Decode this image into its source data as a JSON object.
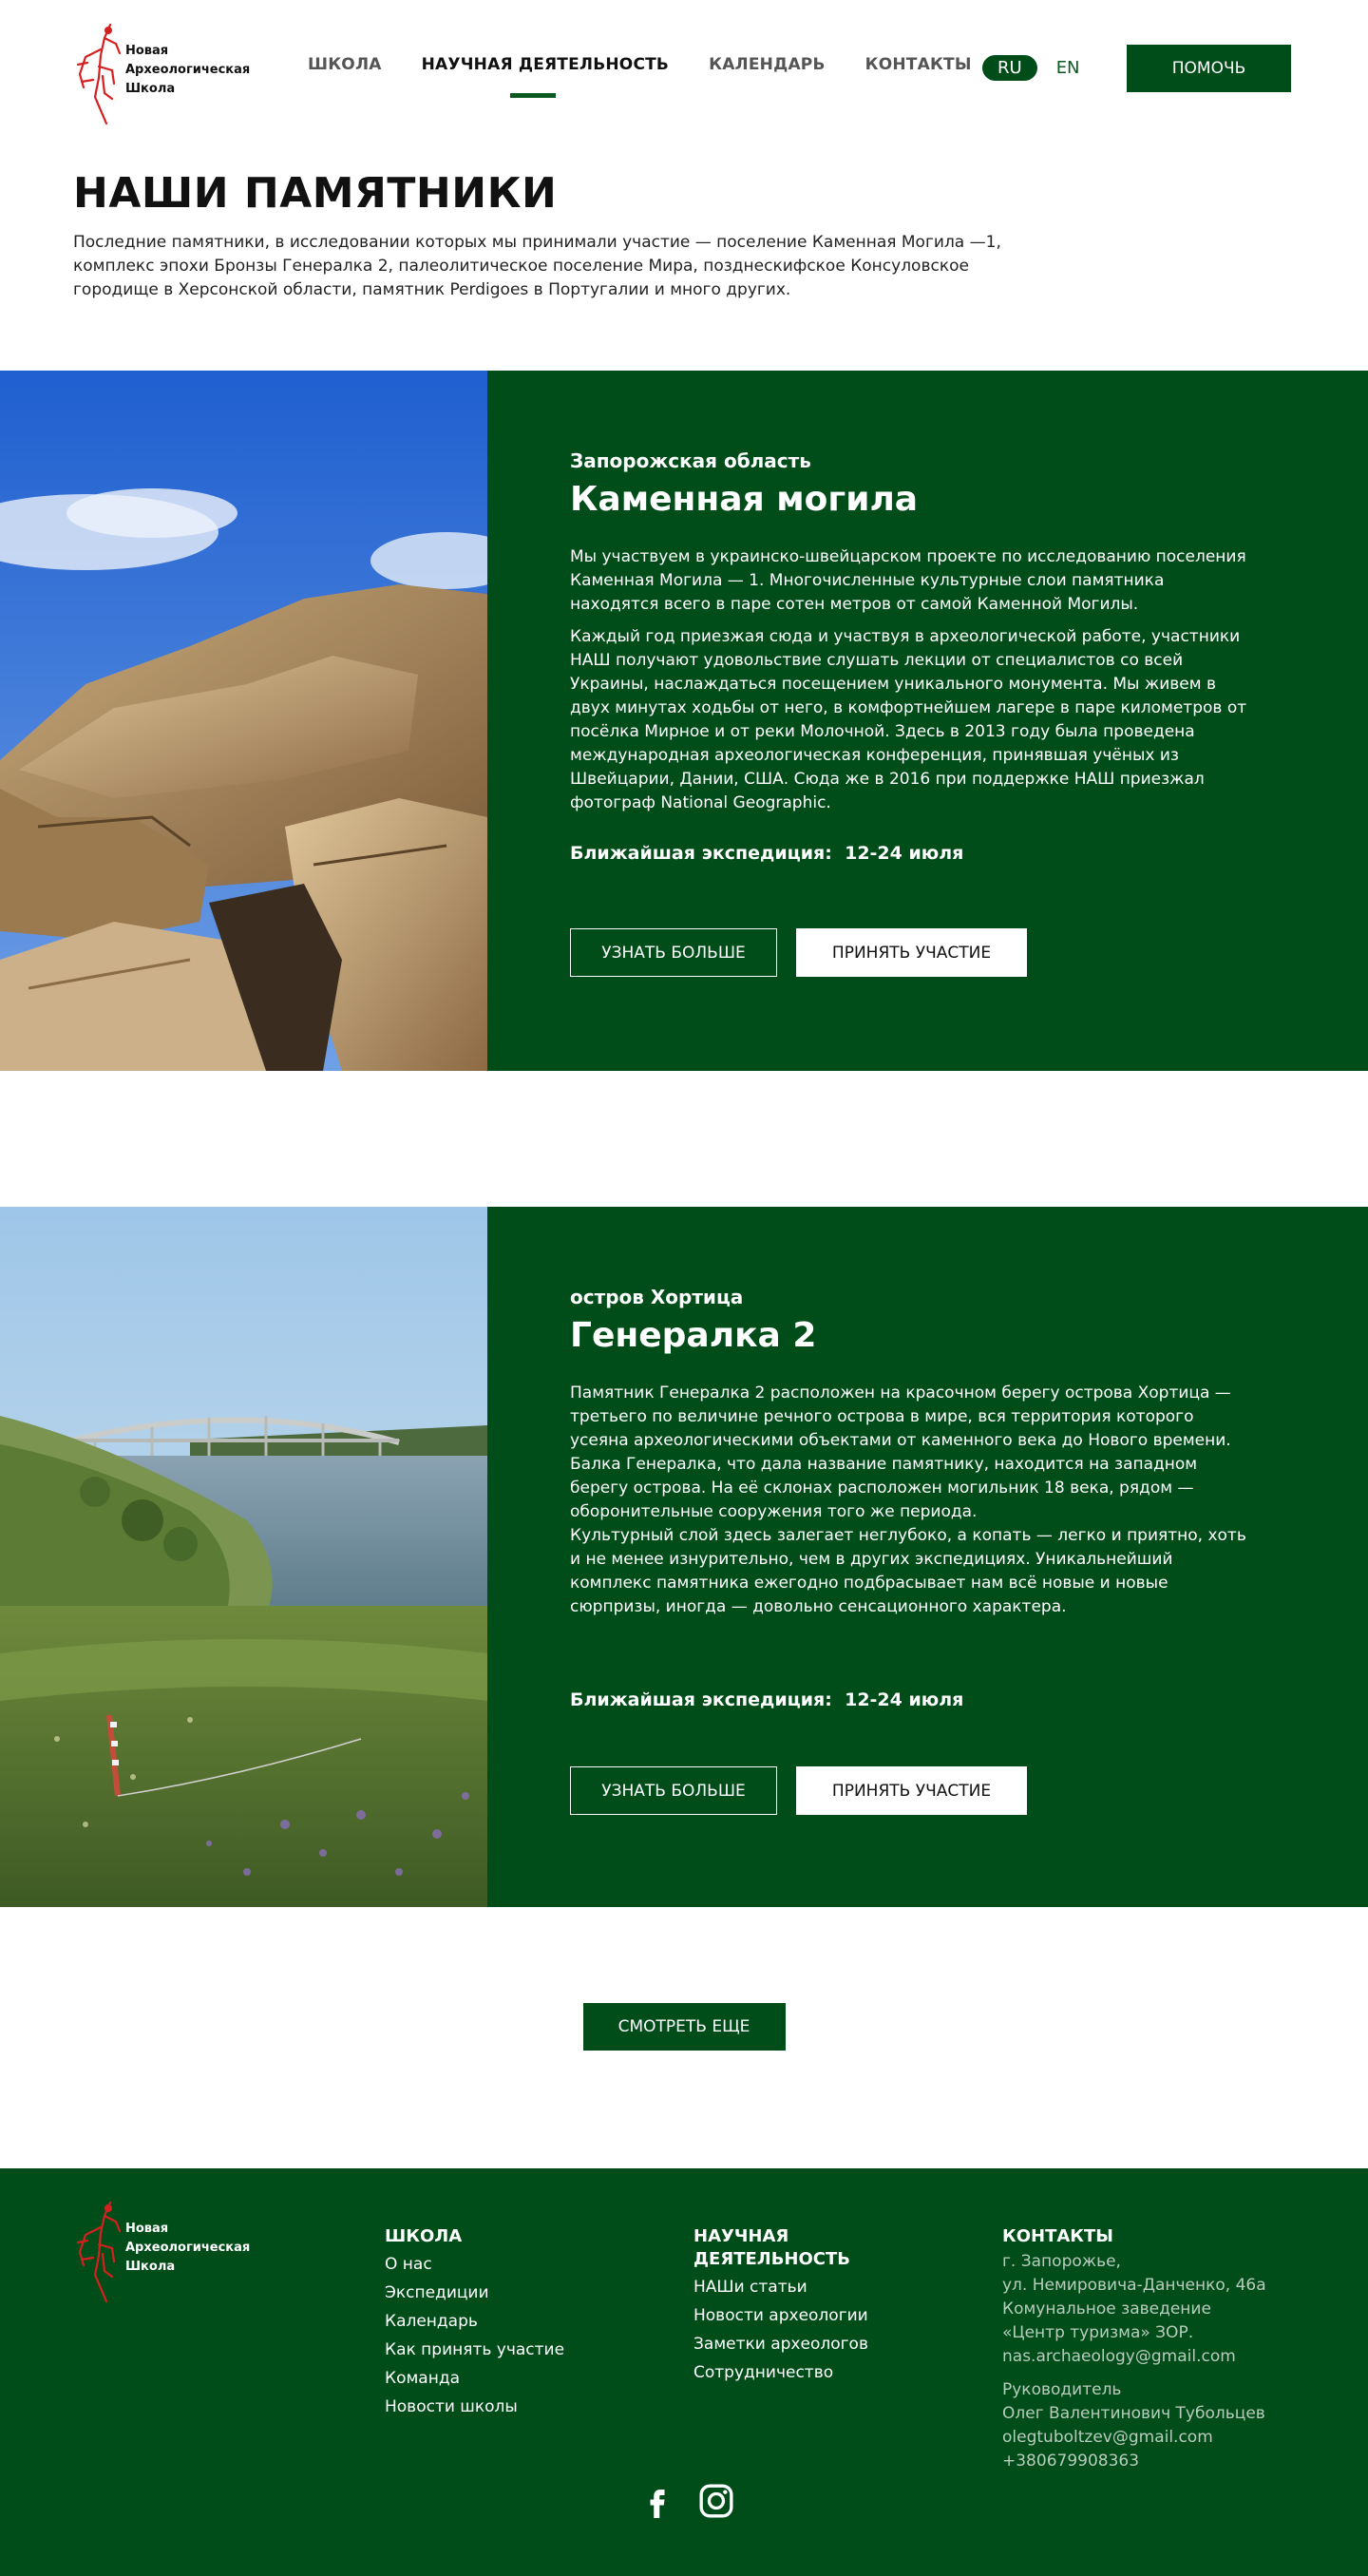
{
  "brand": {
    "logo_line1": "Новая",
    "logo_line2": "Археологическая",
    "logo_line3": "Школа"
  },
  "nav": {
    "items": [
      "ШКОЛА",
      "НАУЧНАЯ ДЕЯТЕЛЬНОСТЬ",
      "КАЛЕНДАРЬ",
      "КОНТАКТЫ"
    ],
    "active": "НАУЧНАЯ ДЕЯТЕЛЬНОСТЬ"
  },
  "lang": {
    "active": "RU",
    "other": "EN"
  },
  "help_button": "ПОМОЧЬ",
  "intro": {
    "title": "НАШИ ПАМЯТНИКИ",
    "text": "Последние  памятники, в исследовании которых мы принимали участие — поселение Каменная Могила —1, комплекс эпохи Бронзы Генералка 2, палеолитическое поселение Мира, позднескифское Консуловское городище в Херсонской области, памятник Perdigoes в Португалии и много других."
  },
  "monuments": [
    {
      "region": "Запорожская область",
      "name": "Каменная могила",
      "paragraphs": [
        "Мы участвуем в украинско-швейцарском проекте по исследованию поселения Каменная Могила — 1. Многочисленные культурные слои памятника находятся всего в паре сотен метров от самой Каменной Могилы.",
        "Каждый год приезжая сюда и участвуя в археологической работе, участники НАШ получают удовольствие слушать лекции от специалистов со всей Украины, наслаждаться посещением уникального монумента. Мы живем в двух минутах ходьбы от него, в комфортнейшем лагере в паре километров от посёлка Мирное и от реки Молочной. Здесь в 2013 году была проведена международная археологическая конференция, принявшая учёных из Швейцарии, Дании, США. Сюда же в 2016 при поддержке НАШ приезжал фотограф National Geographic."
      ],
      "expedition_label": "Ближайшая экспедиция:",
      "expedition_dates": "12-24 июля",
      "learn_more": "УЗНАТЬ БОЛЬШЕ",
      "participate": "ПРИНЯТЬ УЧАСТИЕ"
    },
    {
      "region": "остров Хортица",
      "name": "Генералка 2",
      "paragraphs": [
        "Памятник Генералка 2 расположен на красочном берегу острова Хортица — третьего по величине речного острова в мире, вся территория которого усеяна археологическими объектами от каменного века до Нового времени. Балка Генералка, что дала название памятнику, находится на западном берегу острова. На её склонах расположен могильник 18 века, рядом — оборонительные сооружения того же периода.",
        "Культурный слой здесь залегает неглубоко, а копать — легко и приятно, хоть и не менее изнурительно, чем в других экспедициях. Уникальнейший комплекс памятника ежегодно подбрасывает нам всё новые и новые сюрпризы, иногда — довольно сенсационного характера."
      ],
      "expedition_label": "Ближайшая экспедиция:",
      "expedition_dates": "12-24 июля",
      "learn_more": "УЗНАТЬ БОЛЬШЕ",
      "participate": "ПРИНЯТЬ УЧАСТИЕ"
    }
  ],
  "see_more": "СМОТРЕТЬ ЕЩЕ",
  "footer": {
    "school": {
      "title": "ШКОЛА",
      "links": [
        "О нас",
        "Экспедиции",
        "Календарь",
        "Как принять участие",
        "Команда",
        "Новости школы"
      ]
    },
    "science": {
      "title_line1": "НАУЧНАЯ",
      "title_line2": "ДЕЯТЕЛЬНОСТЬ",
      "links": [
        "НАШи статьи",
        "Новости археологии",
        "Заметки археологов",
        "Сотрудничество"
      ]
    },
    "contacts": {
      "title": "КОНТАКТЫ",
      "address": [
        "г. Запорожье,",
        "ул. Немировича-Данченко, 46а",
        "Комунальное заведение",
        "«Центр туризма» ЗОР.",
        "nas.archaeology@gmail.com"
      ],
      "head": [
        "Руководитель",
        "Олег Валентинович Тубольцев",
        "olegtuboltzev@gmail.com",
        "+380679908363"
      ]
    }
  },
  "colors": {
    "brand_green": "#004d1a",
    "logo_red": "#d62020"
  },
  "icons": [
    "facebook-icon",
    "instagram-icon"
  ]
}
